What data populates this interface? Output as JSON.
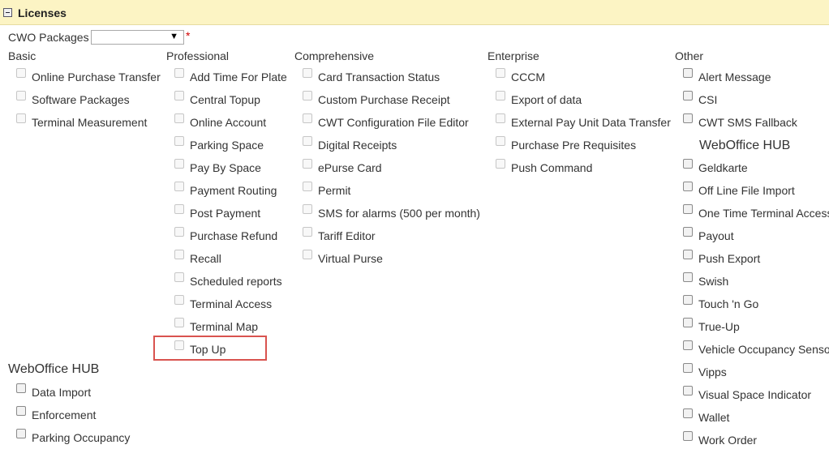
{
  "header": {
    "title": "Licenses"
  },
  "package": {
    "label": "CWO Packages",
    "selected": "",
    "required_mark": "*"
  },
  "columns": {
    "basic": {
      "title": "Basic",
      "items": [
        "Online Purchase Transfer",
        "Software Packages",
        "Terminal Measurement"
      ]
    },
    "professional": {
      "title": "Professional",
      "items": [
        "Add Time For Plate",
        "Central Topup",
        "Online Account",
        "Parking Space",
        "Pay By Space",
        "Payment Routing",
        "Post Payment",
        "Purchase Refund",
        "Recall",
        "Scheduled reports",
        "Terminal Access",
        "Terminal Map",
        "Top Up"
      ]
    },
    "comprehensive": {
      "title": "Comprehensive",
      "items": [
        "Card Transaction Status",
        "Custom Purchase Receipt",
        "CWT Configuration File Editor",
        "Digital Receipts",
        "ePurse Card",
        "Permit",
        "SMS for alarms (500 per month)",
        "Tariff Editor",
        "Virtual Purse"
      ]
    },
    "enterprise": {
      "title": "Enterprise",
      "items": [
        "CCCM",
        "Export of data",
        "External Pay Unit Data Transfer",
        "Purchase Pre Requisites",
        "Push Command"
      ]
    },
    "other": {
      "title": "Other",
      "items": [
        "Alert Message",
        "CSI",
        "CWT SMS Fallback"
      ],
      "hub_title": "WebOffice HUB",
      "hub_items": [
        "Geldkarte",
        "Off Line File Import",
        "One Time Terminal Access",
        "Payout",
        "Push Export",
        "Swish",
        "Touch 'n Go",
        "True-Up",
        "Vehicle Occupancy Sensor",
        "Vipps",
        "Visual Space Indicator",
        "Wallet",
        "Work Order"
      ]
    }
  },
  "hub": {
    "title": "WebOffice HUB",
    "items": [
      "Data Import",
      "Enforcement",
      "Parking Occupancy"
    ]
  }
}
